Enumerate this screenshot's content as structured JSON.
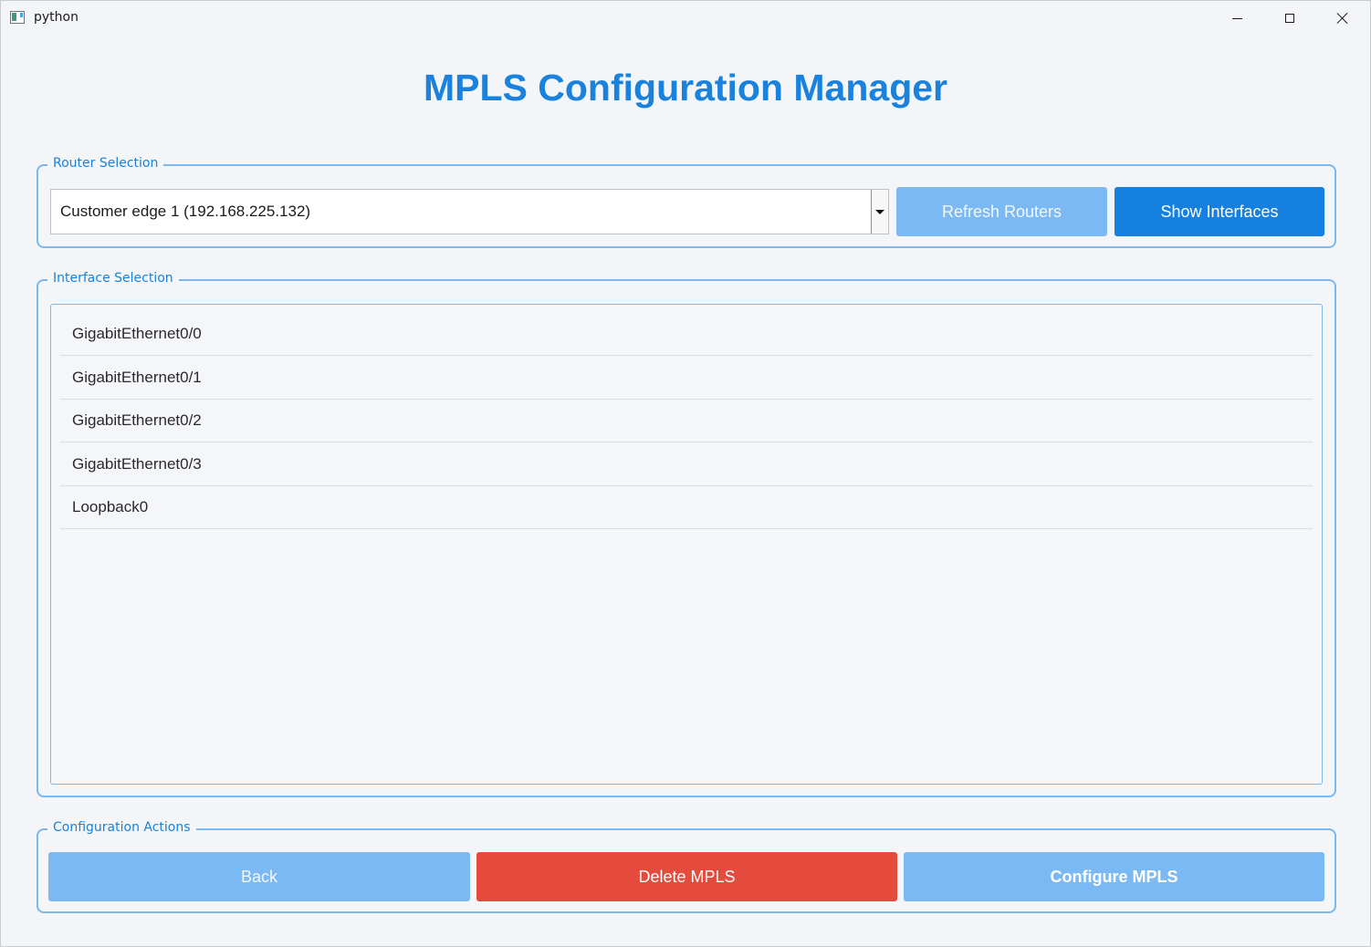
{
  "window": {
    "title": "python",
    "controls": {
      "minimize": "minimize-icon",
      "maximize": "maximize-icon",
      "close": "close-icon"
    }
  },
  "app_title": "MPLS Configuration Manager",
  "router_selection": {
    "label": "Router Selection",
    "selected_router": "Customer edge 1 (192.168.225.132)",
    "refresh_label": "Refresh Routers",
    "show_interfaces_label": "Show Interfaces"
  },
  "interface_selection": {
    "label": "Interface Selection",
    "interfaces": [
      "GigabitEthernet0/0",
      "GigabitEthernet0/1",
      "GigabitEthernet0/2",
      "GigabitEthernet0/3",
      "Loopback0"
    ]
  },
  "actions": {
    "label": "Configuration Actions",
    "back_label": "Back",
    "delete_label": "Delete MPLS",
    "configure_label": "Configure MPLS"
  },
  "colors": {
    "accent": "#1a82dc",
    "primary_button": "#1580e0",
    "disabled_button": "#7bb9f5",
    "danger_button": "#e54b3c",
    "group_border": "#7ab8ef",
    "background": "#f3f5f8"
  }
}
